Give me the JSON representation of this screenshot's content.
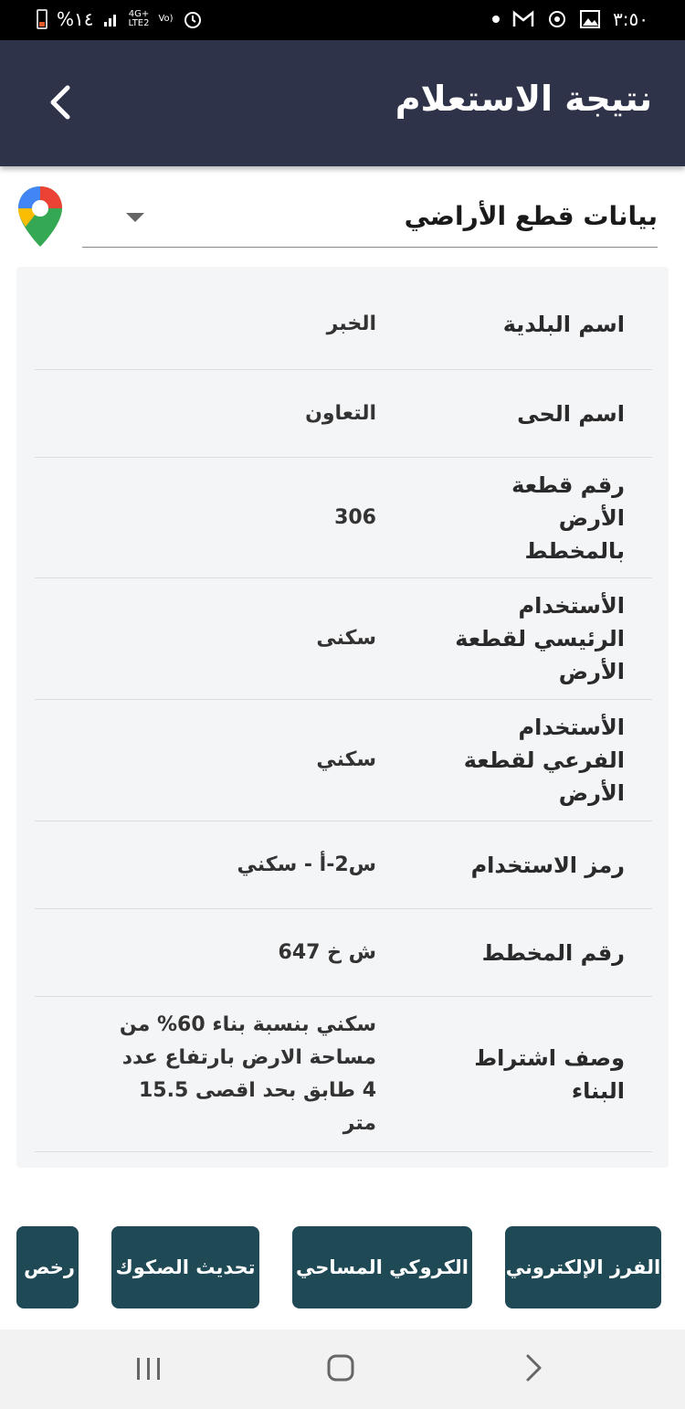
{
  "status_bar": {
    "battery": "%١٤",
    "network_top": "4G+",
    "network_bottom": "LTE2",
    "volte": "Vo)",
    "time": "٣:٥٠"
  },
  "header": {
    "title": "نتيجة الاستعلام"
  },
  "dropdown": {
    "selected": "بيانات قطع الأراضي"
  },
  "rows": [
    {
      "label": "اسم البلدية",
      "value": "الخبر"
    },
    {
      "label": "اسم الحى",
      "value": "التعاون"
    },
    {
      "label": "رقم قطعة الأرض بالمخطط",
      "value": "306"
    },
    {
      "label": "الأستخدام الرئيسي لقطعة الأرض",
      "value": "سكنى"
    },
    {
      "label": "الأستخدام الفرعي لقطعة الأرض",
      "value": "سكني"
    },
    {
      "label": "رمز الاستخدام",
      "value": "س2-أ - سكني"
    },
    {
      "label": "رقم المخطط",
      "value": "ش خ 647"
    },
    {
      "label": "وصف اشتراط البناء",
      "value": "سكني بنسبة بناء 60% من مساحة الارض بارتفاع عدد 4 طابق بحد اقصى 15.5 متر"
    }
  ],
  "actions": [
    {
      "label": "الفرز الإلكتروني"
    },
    {
      "label": "الكروكي المساحي"
    },
    {
      "label": "تحديث الصكوك"
    },
    {
      "label": "رخص ا"
    }
  ],
  "colors": {
    "app_bar": "#2f3349",
    "button": "#1f4a55",
    "card": "#f4f5f7"
  }
}
